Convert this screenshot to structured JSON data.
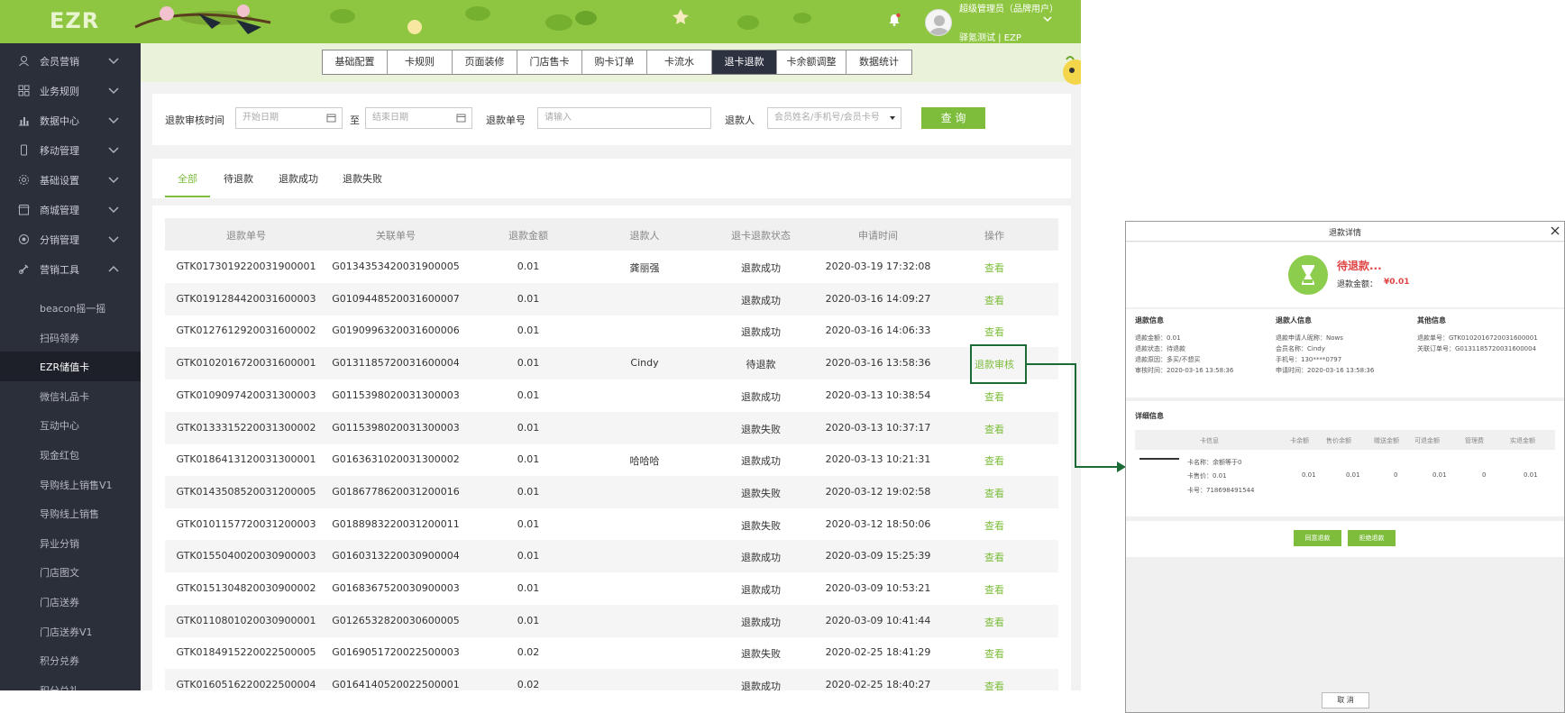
{
  "app": {
    "logo": "EZR",
    "user": {
      "name": "超级管理员（品牌用户）",
      "org": "驿氪测试 | EZP"
    }
  },
  "sidebar": {
    "menus": [
      {
        "label": "会员营销",
        "icon": "members-icon"
      },
      {
        "label": "业务规则",
        "icon": "grid-icon"
      },
      {
        "label": "数据中心",
        "icon": "bar-chart-icon"
      },
      {
        "label": "移动管理",
        "icon": "mobile-icon"
      },
      {
        "label": "基础设置",
        "icon": "gear-icon"
      },
      {
        "label": "商城管理",
        "icon": "store-icon"
      },
      {
        "label": "分销管理",
        "icon": "distribution-icon"
      },
      {
        "label": "营销工具",
        "icon": "tools-icon"
      }
    ],
    "subitems": [
      "beacon摇一摇",
      "扫码领券",
      "EZR储值卡",
      "微信礼品卡",
      "互动中心",
      "现金红包",
      "导购线上销售V1",
      "导购线上销售",
      "异业分销",
      "门店图文",
      "门店送券",
      "门店送券V1",
      "积分兑券",
      "积分兑礼"
    ]
  },
  "tabs": [
    "基础配置",
    "卡规则",
    "页面装修",
    "门店售卡",
    "购卡订单",
    "卡流水",
    "退卡退款",
    "卡余额调整",
    "数据统计"
  ],
  "filters": {
    "time_label": "退款审核时间",
    "start_placeholder": "开始日期",
    "to_label": "至",
    "end_placeholder": "结束日期",
    "refund_no_label": "退款单号",
    "refund_no_placeholder": "请输入",
    "refunder_label": "退款人",
    "refunder_placeholder": "会员姓名/手机号/会员卡号",
    "query_label": "查 询"
  },
  "status_tabs": [
    "全部",
    "待退款",
    "退款成功",
    "退款失败"
  ],
  "table": {
    "headers": [
      "退款单号",
      "关联单号",
      "退款金额",
      "退款人",
      "退卡退款状态",
      "申请时间",
      "操作"
    ],
    "rows": [
      [
        "GTK0173019220031900001",
        "G0134353420031900005",
        "0.01",
        "龚丽强",
        "退款成功",
        "2020-03-19 17:32:08",
        "查看"
      ],
      [
        "GTK0191284420031600003",
        "G0109448520031600007",
        "0.01",
        "",
        "退款成功",
        "2020-03-16 14:09:27",
        "查看"
      ],
      [
        "GTK0127612920031600002",
        "G0190996320031600006",
        "0.01",
        "",
        "退款成功",
        "2020-03-16 14:06:33",
        "查看"
      ],
      [
        "GTK0102016720031600001",
        "G0131185720031600004",
        "0.01",
        "Cindy",
        "待退款",
        "2020-03-16 13:58:36",
        "退款审核"
      ],
      [
        "GTK0109097420031300003",
        "G0115398020031300003",
        "0.01",
        "",
        "退款成功",
        "2020-03-13 10:38:54",
        "查看"
      ],
      [
        "GTK0133315220031300002",
        "G0115398020031300003",
        "0.01",
        "",
        "退款失败",
        "2020-03-13 10:37:17",
        "查看"
      ],
      [
        "GTK0186413120031300001",
        "G0163631020031300002",
        "0.01",
        "哈哈哈",
        "退款成功",
        "2020-03-13 10:21:31",
        "查看"
      ],
      [
        "GTK0143508520031200005",
        "G0186778620031200016",
        "0.01",
        "",
        "退款失败",
        "2020-03-12 19:02:58",
        "查看"
      ],
      [
        "GTK0101157720031200003",
        "G0188983220031200011",
        "0.01",
        "",
        "退款失败",
        "2020-03-12 18:50:06",
        "查看"
      ],
      [
        "GTK0155040020030900003",
        "G0160313220030900004",
        "0.01",
        "",
        "退款成功",
        "2020-03-09 15:25:39",
        "查看"
      ],
      [
        "GTK0151304820030900002",
        "G0168367520030900003",
        "0.01",
        "",
        "退款成功",
        "2020-03-09 10:53:21",
        "查看"
      ],
      [
        "GTK0110801020030900001",
        "G0126532820030600005",
        "0.01",
        "",
        "退款成功",
        "2020-03-09 10:41:44",
        "查看"
      ],
      [
        "GTK0184915220022500005",
        "G0169051720022500003",
        "0.02",
        "",
        "退款失败",
        "2020-02-25 18:41:29",
        "查看"
      ],
      [
        "GTK0160516220022500004",
        "G0164140520022500001",
        "0.02",
        "",
        "退款成功",
        "2020-02-25 18:40:27",
        "查看"
      ]
    ]
  },
  "modal": {
    "title": "退款详情",
    "status": "待退款...",
    "amount_label": "退款金额：",
    "amount_value": "¥0.01",
    "refund_info": {
      "heading": "退款信息",
      "lines": [
        "退款金额：0.01",
        "退款状态：待退款",
        "退款原因：多买/不想买",
        "审核时间：2020-03-16 13:58:36"
      ]
    },
    "refunder_info": {
      "heading": "退款人信息",
      "lines": [
        "退款申请人昵称：Nows",
        "会员名称：Cindy",
        "手机号：130****0797",
        "申请时间：2020-03-16 13:58:36"
      ]
    },
    "other_info": {
      "heading": "其他信息",
      "lines": [
        "退款单号：GTK0102016720031600001",
        "关联订单号：G0131185720031600004"
      ]
    },
    "detail": {
      "heading": "详细信息",
      "headers": [
        "卡信息",
        "卡余额",
        "售价余额",
        "赠送金额",
        "可退金额",
        "管理费",
        "实退金额"
      ],
      "card_lines": [
        "卡名称：余额等于0",
        "卡售价：0.01",
        "卡号：718698491544"
      ],
      "values": [
        "0.01",
        "0.01",
        "0",
        "0.01",
        "0",
        "0.01"
      ]
    },
    "approve_label": "同意退款",
    "reject_label": "拒绝退款",
    "cancel_label": "取 消"
  },
  "colors": {
    "brand_green": "#8fc641",
    "accent_green": "#7dbd3b",
    "sidebar": "#2b2f3a",
    "danger": "#e04545",
    "highlight_border": "#1a6b36"
  }
}
